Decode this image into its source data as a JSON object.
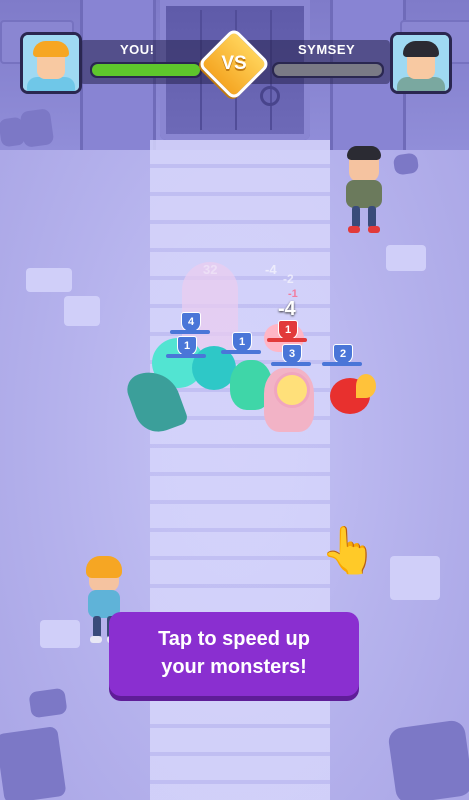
{
  "hud": {
    "player_name": "YOU!",
    "opponent_name": "SYMSEY",
    "vs_label": "VS",
    "player_health": 1.0,
    "opponent_health": 1.0,
    "player_hp_color": "#5ec62c",
    "opponent_hp_color": "#7a7a86"
  },
  "battle": {
    "monster_levels": [
      "4",
      "1",
      "1",
      "1",
      "3",
      "2"
    ],
    "damage_numbers": [
      "-4",
      "-2",
      "-4",
      "-1"
    ],
    "faded_number": "32"
  },
  "tutorial": {
    "line1": "Tap to speed up",
    "line2": "your monsters!",
    "hand_icon": "pointing-hand-icon"
  },
  "colors": {
    "tooltip": "#8a2fd0",
    "friendly_level": "#4a76d8",
    "enemy_level": "#e23a3a"
  }
}
